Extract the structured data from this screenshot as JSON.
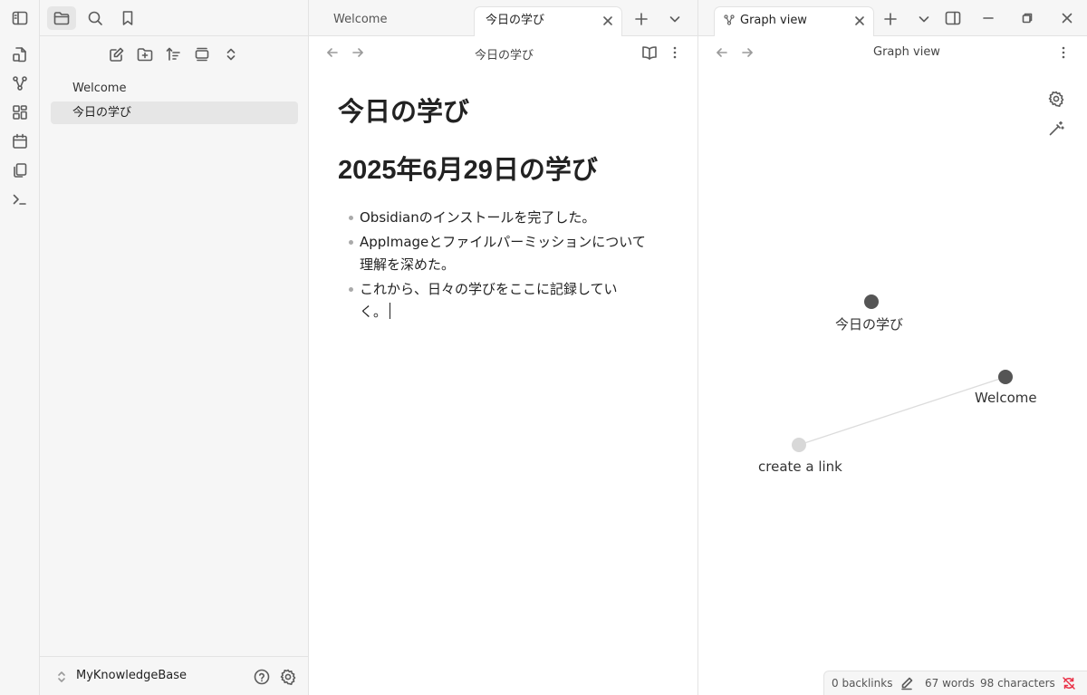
{
  "sidebar": {
    "files": [
      {
        "label": "Welcome"
      },
      {
        "label": "今日の学び"
      }
    ],
    "vault_name": "MyKnowledgeBase"
  },
  "editor": {
    "tabs": [
      {
        "label": "Welcome"
      },
      {
        "label": "今日の学び"
      }
    ],
    "view_title": "今日の学び",
    "note_title": "今日の学び",
    "heading": "2025年6月29日の学び",
    "bullets": [
      "Obsidianのインストールを完了した。",
      "AppImageとファイルパーミッションについて理解を深めた。",
      "これから、日々の学びをここに記録していく。"
    ]
  },
  "graph": {
    "tab_label": "Graph view",
    "view_title": "Graph view",
    "nodes": [
      {
        "label": "今日の学び",
        "color": "#555555"
      },
      {
        "label": "Welcome",
        "color": "#555555"
      },
      {
        "label": "create a link",
        "color": "#d8d8d8"
      }
    ]
  },
  "status": {
    "backlinks": "0 backlinks",
    "words": "67 words",
    "characters": "98 characters"
  },
  "colors": {
    "accent_red": "#e93147",
    "node_dark": "#555555",
    "node_unresolved": "#d8d8d8"
  }
}
